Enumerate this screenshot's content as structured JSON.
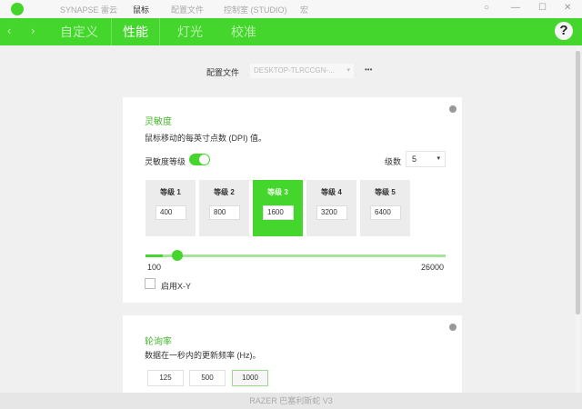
{
  "titlebar": {
    "menu": [
      "SYNAPSE 雷云",
      "鼠标",
      "配置文件",
      "控制室 (STUDIO)",
      "宏"
    ],
    "active": 1
  },
  "nav": {
    "tabs": [
      "自定义",
      "性能",
      "灯光",
      "校准"
    ],
    "active": 1,
    "help": "?"
  },
  "profile": {
    "label": "配置文件",
    "value": "DESKTOP-TLRCCGN-...",
    "more": "•••"
  },
  "sensitivity": {
    "title": "灵敏度",
    "description": "鼠标移动的每英寸点数 (DPI) 值。",
    "stages_label": "灵敏度等级",
    "stages_enabled": true,
    "count_label": "级数",
    "count_value": "5",
    "levels": [
      {
        "label": "等级 1",
        "value": "400"
      },
      {
        "label": "等级 2",
        "value": "800"
      },
      {
        "label": "等级 3",
        "value": "1600"
      },
      {
        "label": "等级 4",
        "value": "3200"
      },
      {
        "label": "等级 5",
        "value": "6400"
      }
    ],
    "active_level": 2,
    "slider_min": "100",
    "slider_max": "26000",
    "slider_value": 1600,
    "xy_label": "启用X-Y",
    "xy_checked": false
  },
  "polling": {
    "title": "轮询率",
    "description": "数据在一秒内的更新频率 (Hz)。",
    "options": [
      "125",
      "500",
      "1000"
    ],
    "selected": "1000"
  },
  "footer": {
    "device": "RAZER 巴塞利斯蛇 V3"
  },
  "colors": {
    "accent": "#44d62c"
  }
}
